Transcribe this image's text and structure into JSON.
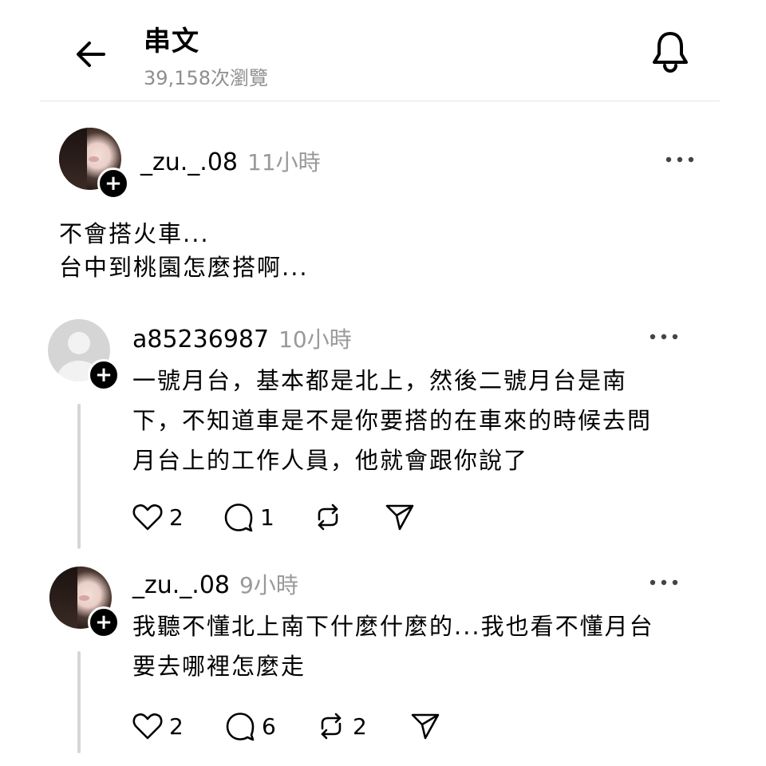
{
  "header": {
    "title": "串文",
    "views": "39,158次瀏覽"
  },
  "post": {
    "username": "_zu._.08",
    "time": "11小時",
    "lines": [
      "不會搭火車...",
      "台中到桃園怎麼搭啊..."
    ]
  },
  "replies": [
    {
      "username": "a85236987",
      "time": "10小時",
      "lines": [
        "一號月台，基本都是北上，然後二號月台是南",
        "下，不知道車是不是你要搭的在車來的時候去問",
        "月台上的工作人員，他就會跟你說了"
      ],
      "likes": "2",
      "comments": "1",
      "reposts": ""
    },
    {
      "username": "_zu._.08",
      "time": "9小時",
      "lines": [
        "我聽不懂北上南下什麼什麼的...我也看不懂月台",
        "要去哪裡怎麼走"
      ],
      "likes": "2",
      "comments": "6",
      "reposts": "2"
    }
  ],
  "icons": {
    "back": "arrow-left-icon",
    "notify": "bell-icon",
    "follow": "plus-icon",
    "more": "more-horizontal-icon",
    "like": "heart-icon",
    "comment": "comment-icon",
    "repost": "repost-icon",
    "share": "send-icon"
  }
}
